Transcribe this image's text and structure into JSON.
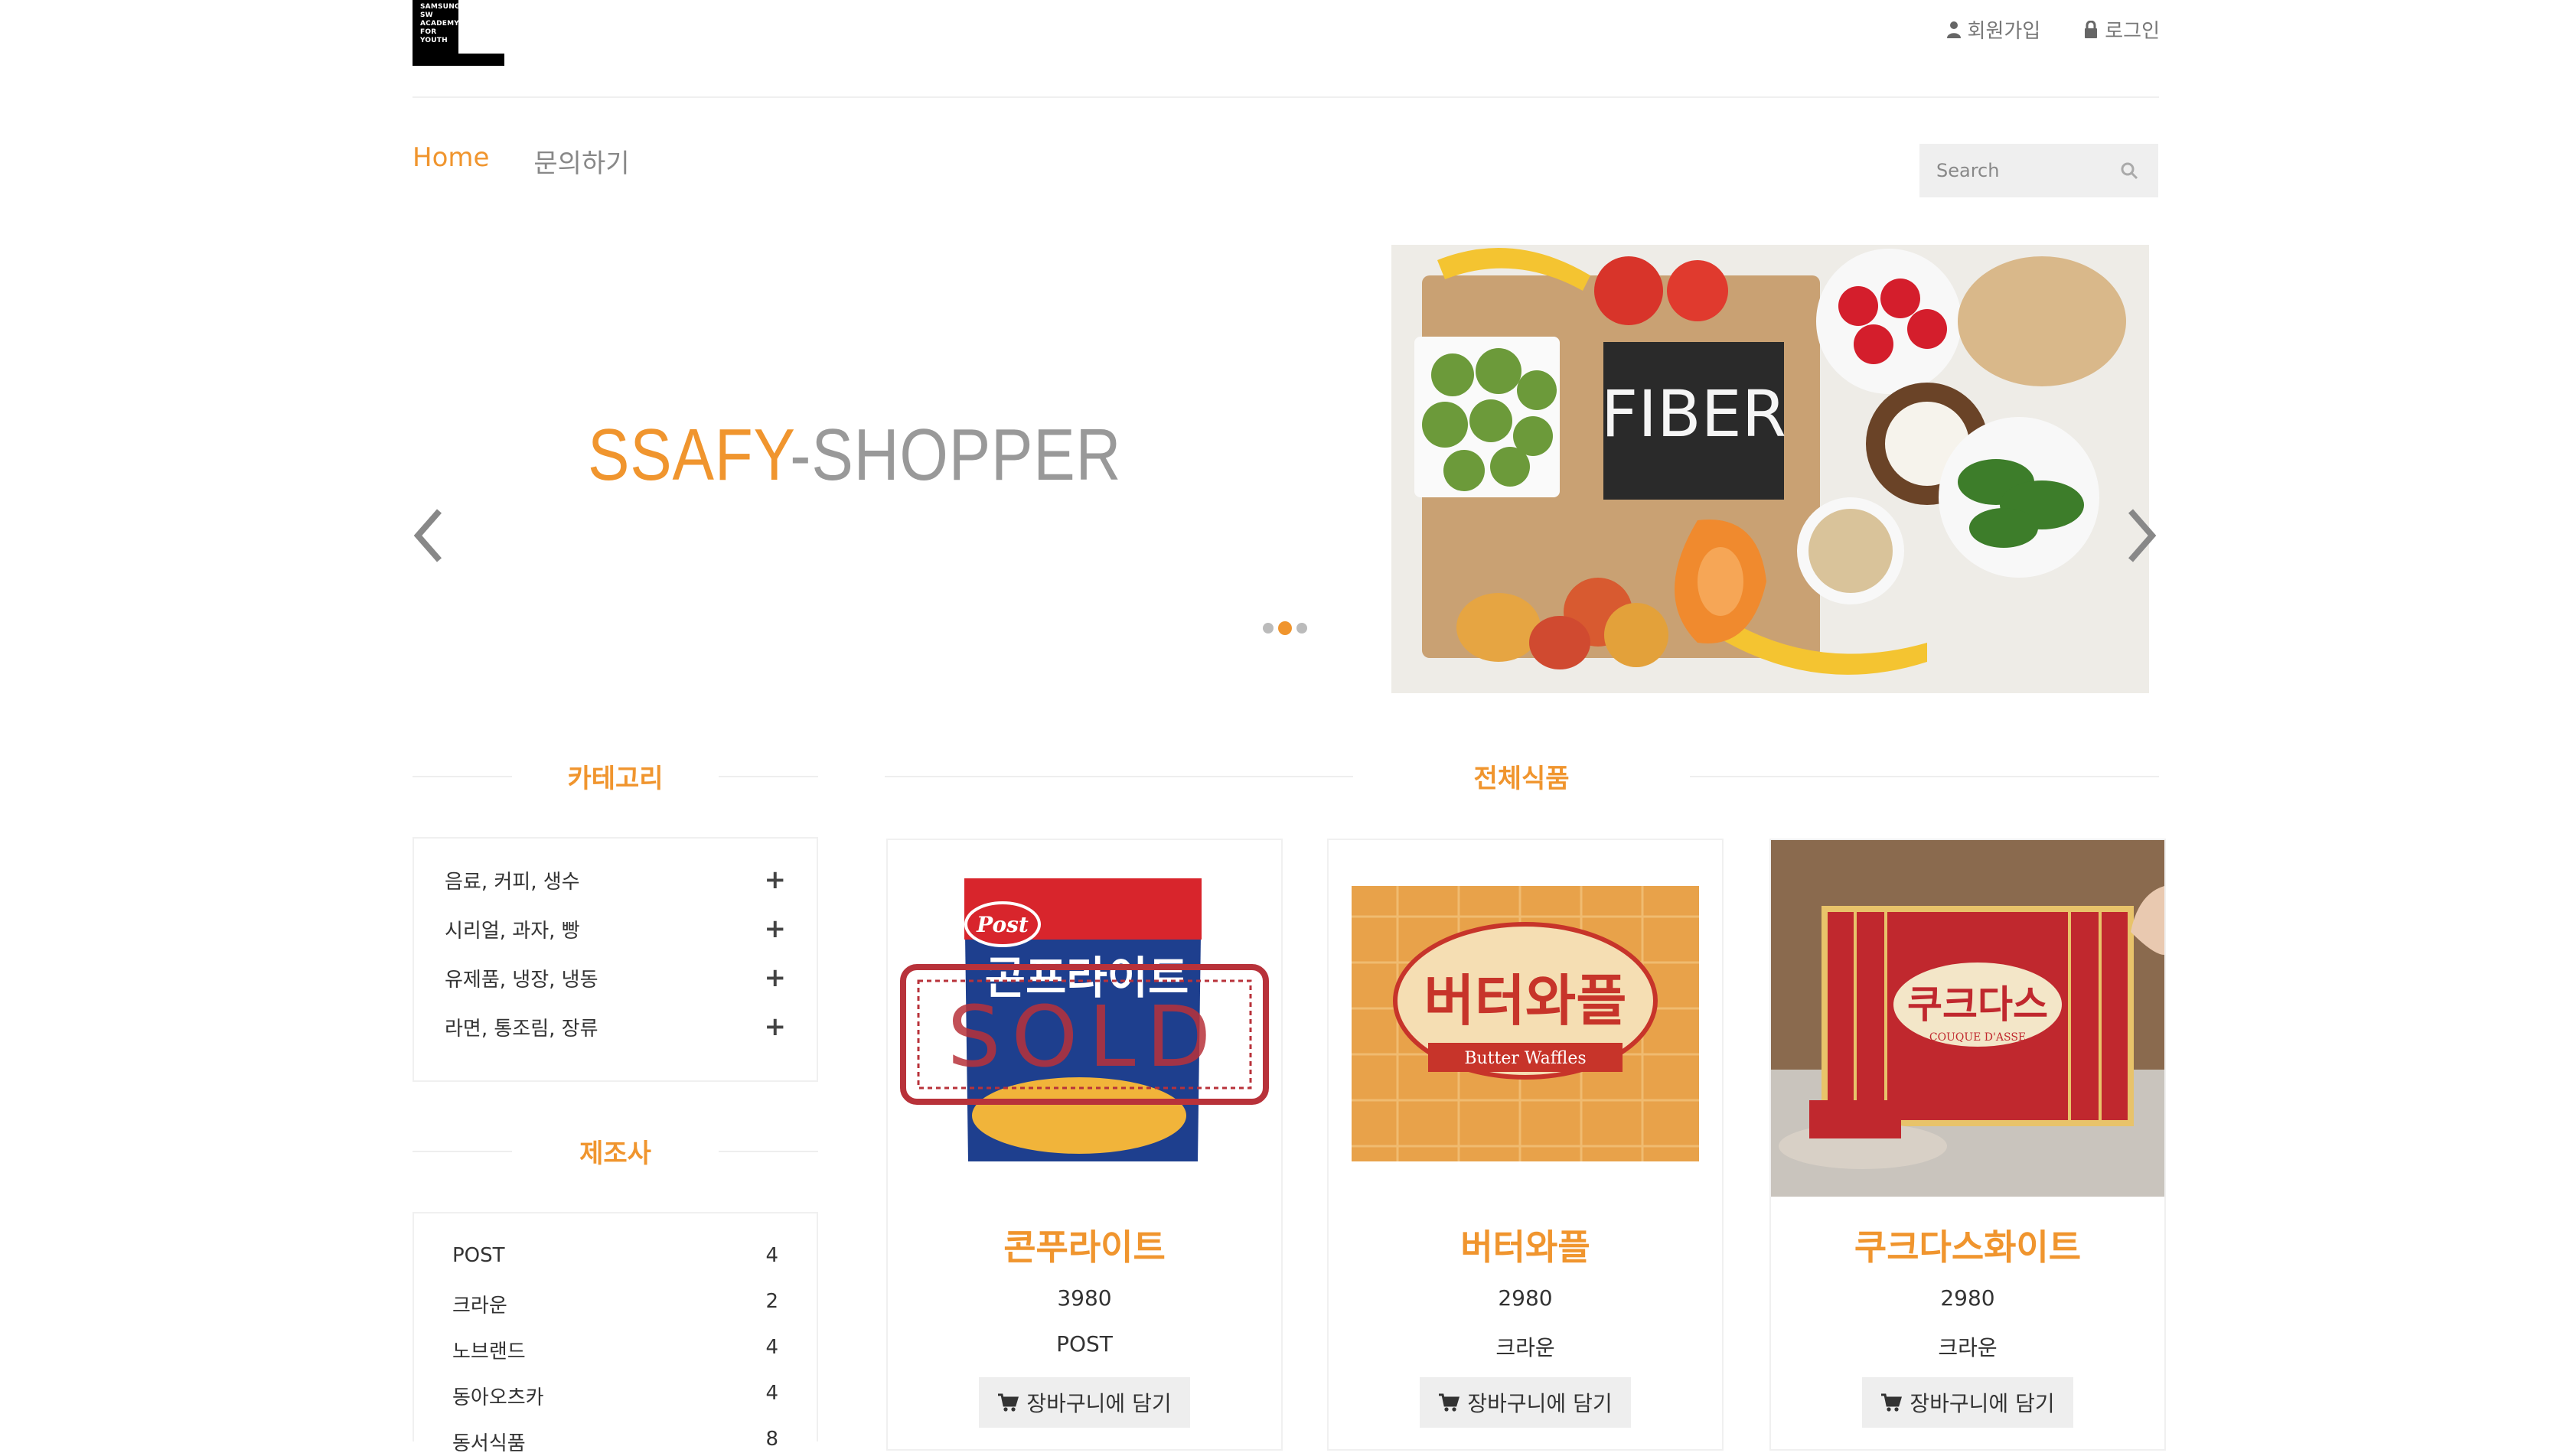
{
  "header": {
    "logo_lines": [
      "SAMSUNG",
      "SW",
      "ACADEMY",
      "FOR",
      "YOUTH"
    ],
    "signup": "회원가입",
    "login": "로그인"
  },
  "nav": {
    "home": "Home",
    "inquiry": "문의하기"
  },
  "search": {
    "placeholder": "Search"
  },
  "hero": {
    "title_part1": "SSAFY",
    "title_part2": "-SHOPPER",
    "image_label": "FIBER",
    "slides": 3,
    "active_slide": 2
  },
  "sidebar": {
    "category_title": "카테고리",
    "categories": [
      {
        "label": "음료, 커피, 생수",
        "icon": "plus-icon"
      },
      {
        "label": "시리얼, 과자, 빵",
        "icon": "plus-icon"
      },
      {
        "label": "유제품, 냉장, 냉동",
        "icon": "plus-icon"
      },
      {
        "label": "라면, 통조림, 장류",
        "icon": "plus-icon"
      }
    ],
    "manufacturer_title": "제조사",
    "manufacturers": [
      {
        "name": "POST",
        "count": "4"
      },
      {
        "name": "크라운",
        "count": "2"
      },
      {
        "name": "노브랜드",
        "count": "4"
      },
      {
        "name": "동아오츠카",
        "count": "4"
      },
      {
        "name": "동서식품",
        "count": "8"
      }
    ]
  },
  "main": {
    "title": "전체식품",
    "cart_label": "장바구니에 담기",
    "products": [
      {
        "name": "콘푸라이트",
        "price": "3980",
        "maker": "POST",
        "sold": true,
        "sold_label": "SOLD",
        "package_text": "콘프라이트",
        "brand_text": "Post"
      },
      {
        "name": "버터와플",
        "price": "2980",
        "maker": "크라운",
        "sold": false,
        "package_text": "버터와플",
        "brand_text": "Butter Waffles"
      },
      {
        "name": "쿠크다스화이트",
        "price": "2980",
        "maker": "크라운",
        "sold": false,
        "package_text": "쿠크다스",
        "brand_text": "COUQUE D'ASSE"
      }
    ]
  },
  "colors": {
    "accent": "#f0952e",
    "muted": "#999999",
    "sold_stamp": "#b8323a"
  }
}
